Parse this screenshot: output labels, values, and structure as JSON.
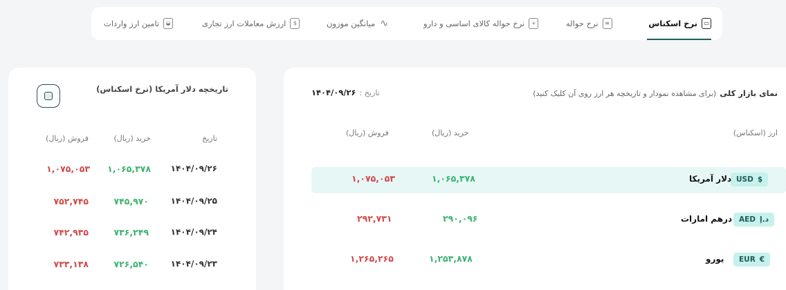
{
  "tabs": [
    {
      "label": "نرخ اسکناس",
      "icon": "banknote-icon",
      "active": true
    },
    {
      "label": "نرخ حواله",
      "icon": "document-icon",
      "active": false
    },
    {
      "label": "نرخ حواله کالای اساسی و دارو",
      "icon": "medicine-icon",
      "active": false
    },
    {
      "label": "میانگین موزون",
      "icon": "chart-line-icon",
      "active": false
    },
    {
      "label": "ارزش معاملات ارز تجاری",
      "icon": "bag-icon",
      "active": false
    },
    {
      "label": "تامین ارز واردات",
      "icon": "hand-coin-icon",
      "active": false
    }
  ],
  "history": {
    "title": "تاریخچه دلار آمریکا (نرخ اسکناس)",
    "headers": {
      "date": "تاریخ",
      "buy": "خرید (ریال)",
      "sell": "فروش (ریال)"
    },
    "rows": [
      {
        "date": "۱۴۰۴/۰۹/۲۶",
        "buy": "۱,۰۶۵,۳۷۸",
        "sell": "۱,۰۷۵,۰۵۳"
      },
      {
        "date": "۱۴۰۴/۰۹/۲۵",
        "buy": "۷۴۵,۹۷۰",
        "sell": "۷۵۲,۷۴۵"
      },
      {
        "date": "۱۴۰۴/۰۹/۲۴",
        "buy": "۷۳۶,۲۴۹",
        "sell": "۷۴۲,۹۳۵"
      },
      {
        "date": "۱۴۰۴/۰۹/۲۳",
        "buy": "۷۲۶,۵۴۰",
        "sell": "۷۳۳,۱۳۸"
      }
    ]
  },
  "market": {
    "title": "نمای بازار کلی",
    "subtitle": "(برای مشاهده نمودار و تاریخچه هر ارز روی آن کلیک کنید)",
    "date_label": "تاریخ :",
    "date_value": "۱۴۰۴/۰۹/۲۶",
    "headers": {
      "currency": "ارز (اسکناس)",
      "buy": "خرید (ریال)",
      "sell": "فروش (ریال)"
    },
    "rows": [
      {
        "code": "USD",
        "symbol": "$",
        "name": "دلار آمریکا",
        "buy": "۱,۰۶۵,۳۷۸",
        "sell": "۱,۰۷۵,۰۵۳",
        "highlighted": true
      },
      {
        "code": "AED",
        "symbol": "د.إ",
        "name": "درهم امارات",
        "buy": "۲۹۰,۰۹۶",
        "sell": "۲۹۲,۷۳۱",
        "highlighted": false
      },
      {
        "code": "EUR",
        "symbol": "€",
        "name": "یورو",
        "buy": "۱,۲۵۳,۸۷۸",
        "sell": "۱,۲۶۵,۲۶۵",
        "highlighted": false
      }
    ]
  },
  "colors": {
    "accent": "#1f5f5b",
    "buy": "#3cb371",
    "sell": "#d14b4b",
    "highlight": "#e6f7f5"
  }
}
